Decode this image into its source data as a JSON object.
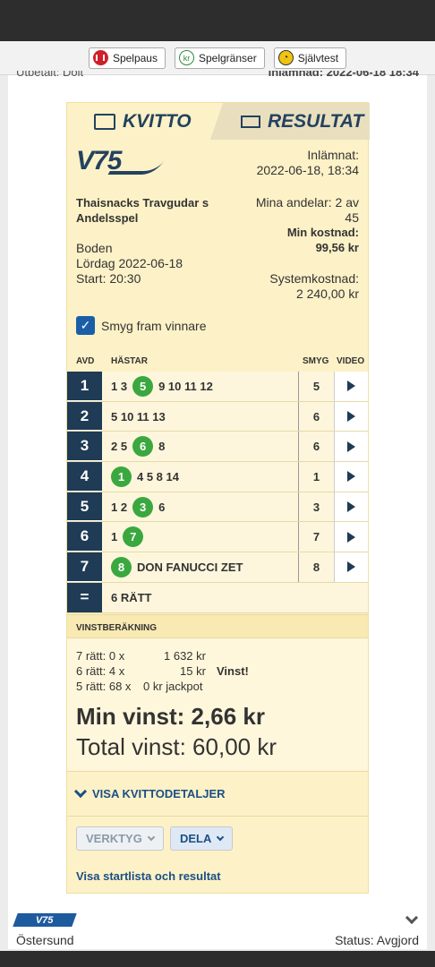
{
  "toolbar": {
    "spelpaus": "Spelpaus",
    "spelgranser": "Spelgränser",
    "sjalvtest": "Självtest"
  },
  "cutoff": {
    "left": "Utbetalt: Doit",
    "right": "Inlämnad: 2022-06-18 18:34"
  },
  "tabs": {
    "kvitto": "KVITTO",
    "resultat": "RESULTAT"
  },
  "logo": "V75",
  "receipt": {
    "inlamnat_label": "Inlämnat:",
    "inlamnat_value": "2022-06-18, 18:34",
    "name_line1": "Thaisnacks Travgudar s",
    "name_line2": "Andelsspel",
    "andelar_line1": "Mina andelar: 2 av",
    "andelar_line2": "45",
    "kostnad_label": "Min kostnad:",
    "kostnad_value": "99,56 kr",
    "track": "Boden",
    "date": "Lördag 2022-06-18",
    "start": "Start: 20:30",
    "systemkostnad_label": "Systemkostnad:",
    "systemkostnad_value": "2 240,00 kr",
    "smyg_label": "Smyg fram vinnare",
    "headers": {
      "avd": "AVD",
      "hastar": "HÄSTAR",
      "smyg": "SMYG",
      "video": "VIDEO"
    },
    "rows": [
      {
        "avd": "1",
        "smyg": "5"
      },
      {
        "avd": "2",
        "smyg": "6"
      },
      {
        "avd": "3",
        "smyg": "6"
      },
      {
        "avd": "4",
        "smyg": "1"
      },
      {
        "avd": "5",
        "smyg": "3"
      },
      {
        "avd": "6",
        "smyg": "7"
      },
      {
        "avd": "7",
        "smyg": "8"
      }
    ],
    "sum_symbol": "=",
    "sum_label": "6 RÄTT",
    "vinstberakning": "VINSTBERÄKNING",
    "calc": {
      "r7_left": "7 rätt: 0 x",
      "r7_right": "1 632 kr",
      "r6_left": "6 rätt: 4 x",
      "r6_right": "15 kr",
      "r6_flag": "Vinst!",
      "r5_left": "5 rätt: 68 x",
      "r5_right": "0 kr jackpot"
    },
    "min_vinst": "Min vinst: 2,66 kr",
    "total_vinst": "Total vinst: 60,00 kr",
    "visa_detaljer": "VISA KVITTODETALJER",
    "verktyg": "VERKTYG",
    "dela": "DELA",
    "startlista_link": "Visa startlista och resultat"
  },
  "bottom_card": {
    "badge": "V75",
    "track": "Östersund",
    "status": "Status: Avgjord"
  }
}
